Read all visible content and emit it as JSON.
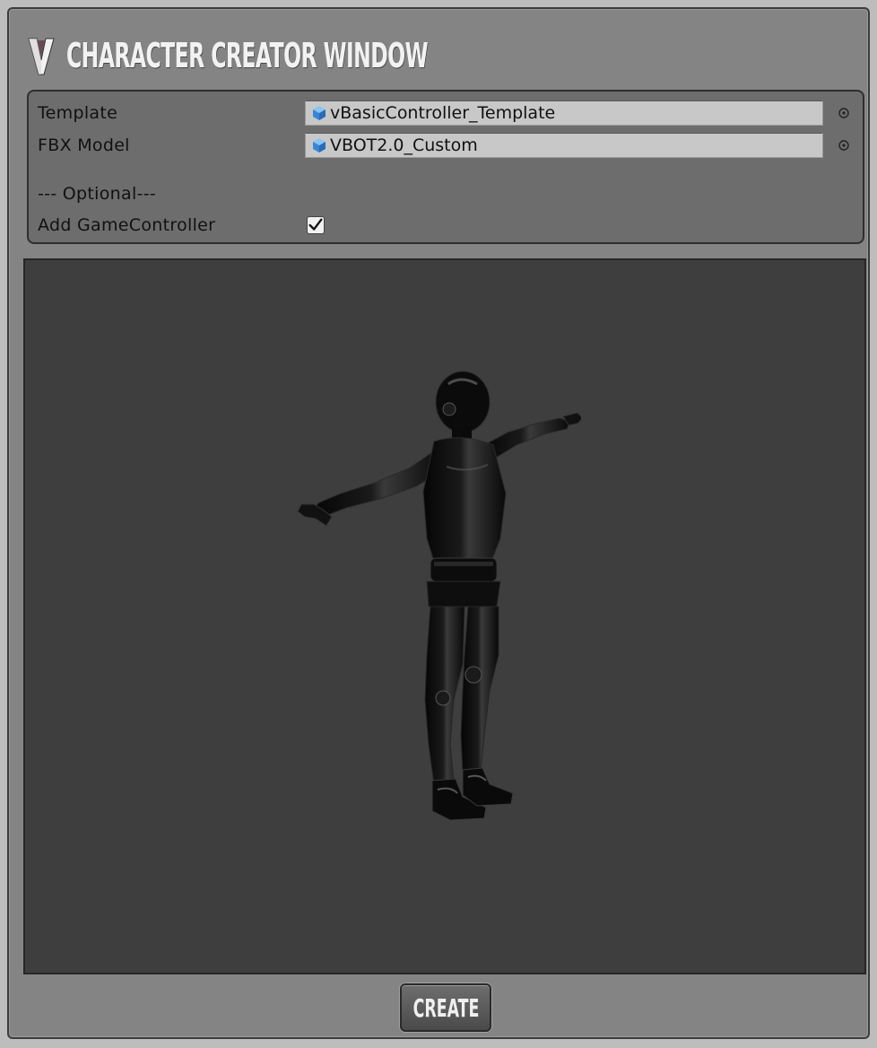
{
  "window": {
    "title": "CHARACTER CREATOR WINDOW"
  },
  "fields": {
    "template": {
      "label": "Template",
      "value": "vBasicController_Template",
      "icon": "prefab-cube-icon"
    },
    "fbx_model": {
      "label": "FBX Model",
      "value": "VBOT2.0_Custom",
      "icon": "prefab-cube-icon"
    },
    "optional_header": "--- Optional---",
    "add_game_controller": {
      "label": "Add GameController",
      "checked": true
    }
  },
  "preview": {
    "subject": "character-model-preview"
  },
  "actions": {
    "create_label": "CREATE"
  },
  "colors": {
    "window_bg": "#848484",
    "panel_bg": "#6d6d6d",
    "preview_bg": "#3e3e3e",
    "field_bg": "#c8c8c8",
    "cube_icon": "#4a9be8"
  }
}
